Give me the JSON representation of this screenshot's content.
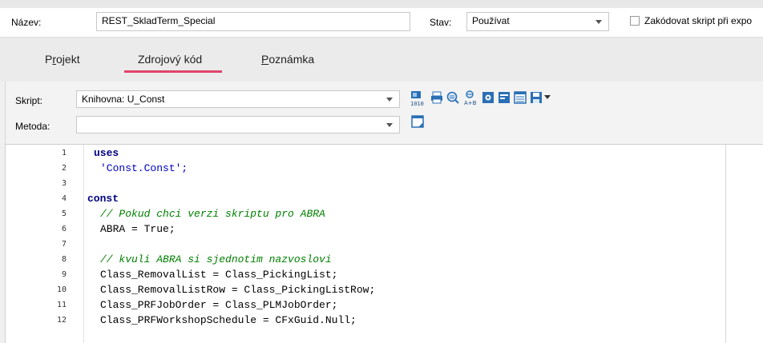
{
  "header": {
    "name_label": "Název:",
    "name_value": "REST_SkladTerm_Special",
    "state_label": "Stav:",
    "state_value": "Používat",
    "encode_label": "Zakódovat skript při expo"
  },
  "tabs": [
    {
      "label": "Projekt",
      "underline_char": "r"
    },
    {
      "label": "Zdrojový kód",
      "active": true
    },
    {
      "label": "Poznámka",
      "underline_char": "P"
    }
  ],
  "script": {
    "script_label": "Skript:",
    "script_value": "Knihovna: U_Const",
    "method_label": "Metoda:",
    "method_value": ""
  },
  "toolbar_icons": [
    "compile-icon",
    "print-icon",
    "find-icon",
    "replace-icon",
    "settings-icon",
    "note-icon",
    "list-icon",
    "save-icon"
  ],
  "code_lines": [
    {
      "n": "1",
      "text": "uses"
    },
    {
      "n": "2",
      "text": "'Const.Const';"
    },
    {
      "n": "3",
      "text": ""
    },
    {
      "n": "4",
      "text": "const"
    },
    {
      "n": "5",
      "text": "// Pokud chci verzi skriptu pro ABRA"
    },
    {
      "n": "6",
      "text": "ABRA = True;"
    },
    {
      "n": "7",
      "text": ""
    },
    {
      "n": "8",
      "text": "// kvuli ABRA si sjednotim nazvoslovi"
    },
    {
      "n": "9",
      "text": "Class_RemovalList = Class_PickingList;"
    },
    {
      "n": "10",
      "text": "Class_RemovalListRow = Class_PickingListRow;"
    },
    {
      "n": "11",
      "text": "Class_PRFJobOrder = Class_PLMJobOrder;"
    },
    {
      "n": "12",
      "text": "Class_PRFWorkshopSchedule = CFxGuid.Null;"
    }
  ],
  "colors": {
    "accent": "#e0456b",
    "keyword": "#000080",
    "string": "#0000c0",
    "comment": "#008000"
  }
}
